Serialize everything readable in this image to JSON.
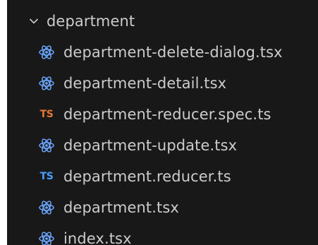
{
  "explorer": {
    "folder": {
      "name": "department",
      "expanded": true,
      "chevron_icon": "chevron-down-icon"
    },
    "files": [
      {
        "name": "department-delete-dialog.tsx",
        "icon": "react-icon",
        "icon_color": "#6ba7ff"
      },
      {
        "name": "department-detail.tsx",
        "icon": "react-icon",
        "icon_color": "#6ba7ff"
      },
      {
        "name": "department-reducer.spec.ts",
        "icon": "typescript-test-icon",
        "icon_text": "TS",
        "icon_color": "#e37933"
      },
      {
        "name": "department-update.tsx",
        "icon": "react-icon",
        "icon_color": "#6ba7ff"
      },
      {
        "name": "department.reducer.ts",
        "icon": "typescript-icon",
        "icon_text": "TS",
        "icon_color": "#4a9eff"
      },
      {
        "name": "department.tsx",
        "icon": "react-icon",
        "icon_color": "#6ba7ff"
      },
      {
        "name": "index.tsx",
        "icon": "react-icon",
        "icon_color": "#6ba7ff"
      }
    ]
  },
  "colors": {
    "background": "#181818",
    "text": "#cccccc"
  }
}
